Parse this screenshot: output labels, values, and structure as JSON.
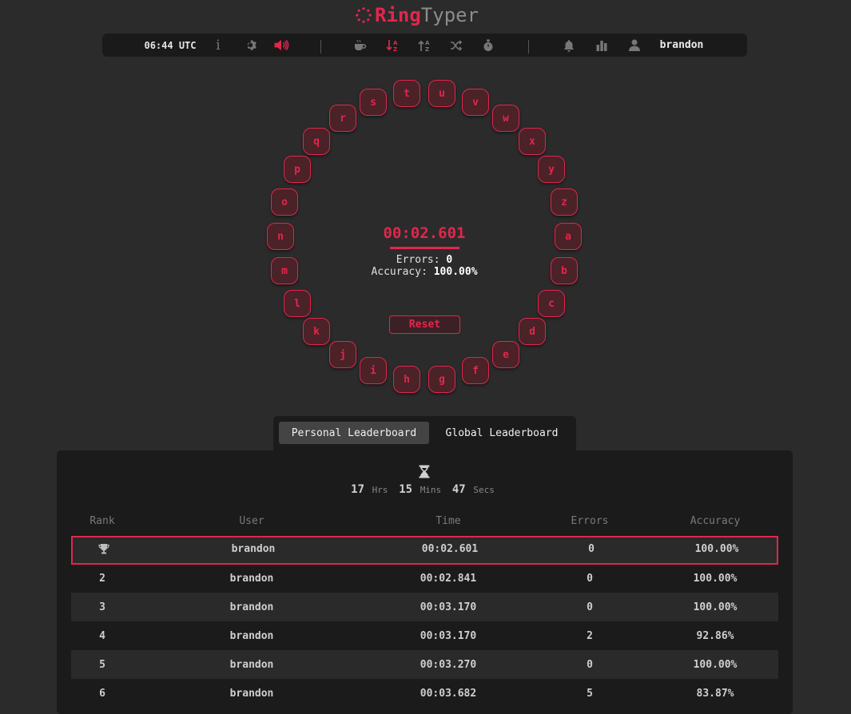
{
  "app": {
    "logo": {
      "part1": "Ring",
      "part2": "Typer"
    },
    "accent": "#e2264d"
  },
  "toolbar": {
    "clock": "06:44 UTC",
    "info_icon": "i",
    "icons": [
      "gear-icon",
      "volume-icon",
      "coffee-icon",
      "sort-az-icon",
      "sort-za-icon",
      "shuffle-icon",
      "stopwatch-icon",
      "bell-icon",
      "bar-chart-icon",
      "user-icon"
    ],
    "user": "brandon"
  },
  "ring": {
    "letters": [
      "t",
      "u",
      "v",
      "w",
      "x",
      "y",
      "z",
      "a",
      "b",
      "c",
      "d",
      "e",
      "f",
      "g",
      "h",
      "i",
      "j",
      "k",
      "l",
      "m",
      "n",
      "o",
      "p",
      "q",
      "r",
      "s"
    ]
  },
  "stats": {
    "timer": "00:02.601",
    "errors_label": "Errors:",
    "errors_value": "0",
    "accuracy_label": "Accuracy:",
    "accuracy_value": "100.00%",
    "reset_label": "Reset"
  },
  "leaderboard": {
    "tabs": [
      "Personal Leaderboard",
      "Global Leaderboard"
    ],
    "countdown": {
      "hours": "17",
      "hours_unit": "Hrs",
      "mins": "15",
      "mins_unit": "Mins",
      "secs": "47",
      "secs_unit": "Secs"
    },
    "columns": [
      "Rank",
      "User",
      "Time",
      "Errors",
      "Accuracy"
    ],
    "rows": [
      {
        "rank": "",
        "trophy": true,
        "user": "brandon",
        "time": "00:02.601",
        "errors": "0",
        "accuracy": "100.00%"
      },
      {
        "rank": "2",
        "user": "brandon",
        "time": "00:02.841",
        "errors": "0",
        "accuracy": "100.00%"
      },
      {
        "rank": "3",
        "user": "brandon",
        "time": "00:03.170",
        "errors": "0",
        "accuracy": "100.00%"
      },
      {
        "rank": "4",
        "user": "brandon",
        "time": "00:03.170",
        "errors": "2",
        "accuracy": "92.86%"
      },
      {
        "rank": "5",
        "user": "brandon",
        "time": "00:03.270",
        "errors": "0",
        "accuracy": "100.00%"
      },
      {
        "rank": "6",
        "user": "brandon",
        "time": "00:03.682",
        "errors": "5",
        "accuracy": "83.87%"
      }
    ]
  }
}
